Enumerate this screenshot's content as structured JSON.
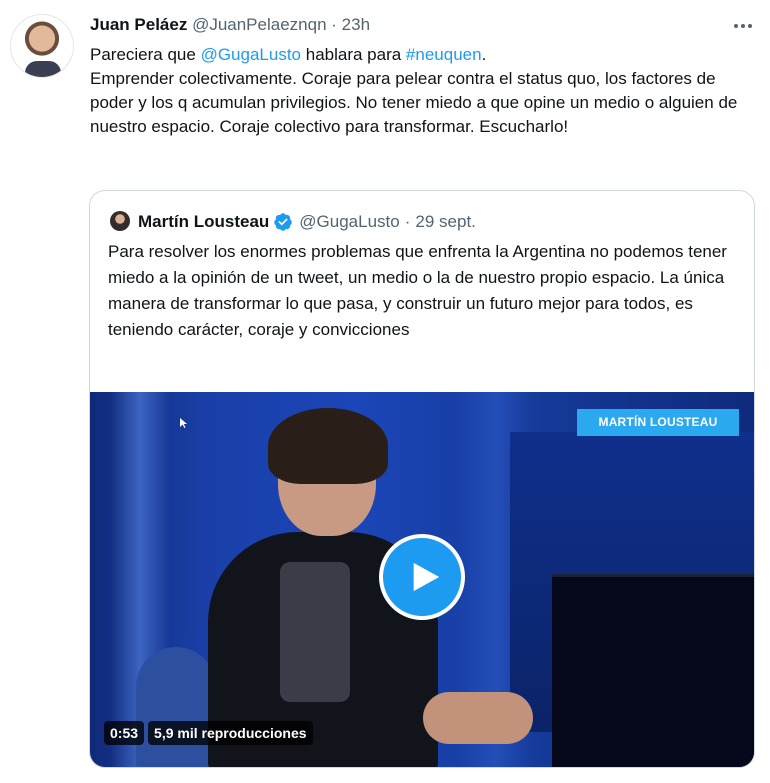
{
  "tweet": {
    "author_name": "Juan Peláez",
    "author_handle": "@JuanPelaeznqn",
    "separator": "·",
    "timestamp": "23h",
    "text_part1": "Pareciera que ",
    "mention": "@GugaLusto",
    "text_part2": " hablara para ",
    "hashtag": "#neuquen",
    "text_part3": ".",
    "paragraph2": "Emprender colectivamente. Coraje para pelear contra el status quo, los factores de poder y los q acumulan privilegios. No tener miedo a que opine un medio o alguien de nuestro espacio. Coraje colectivo para transformar. Escucharlo!"
  },
  "quoted_tweet": {
    "author_name": "Martín Lousteau",
    "author_handle": "@GugaLusto",
    "separator": "·",
    "date": "29 sept.",
    "text": "Para resolver los enormes problemas que enfrenta la Argentina no podemos tener miedo a la opinión de un tweet, un medio o la de nuestro propio espacio. La única manera de transformar lo que pasa,  y construir un futuro mejor para todos, es teniendo carácter, coraje y convicciones"
  },
  "video": {
    "overlay_label": "MARTÍN LOUSTEAU",
    "duration": "0:53",
    "views": "5,9 mil reproducciones"
  },
  "icons": {
    "more": "more-options-icon",
    "verified": "verified-badge-icon",
    "play": "play-icon"
  },
  "colors": {
    "link": "#1d9bf0",
    "secondary_text": "#536471",
    "border": "#cfd9de",
    "video_tag": "#2aa9f0"
  }
}
